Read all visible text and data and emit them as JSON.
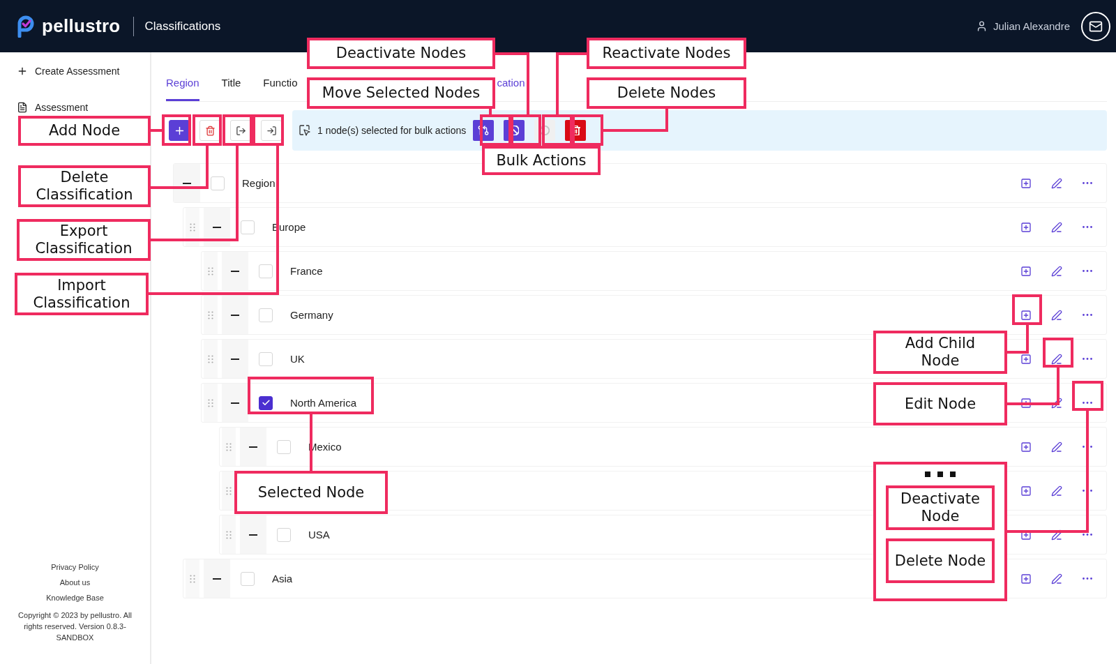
{
  "header": {
    "brand": "pellustro",
    "page_title": "Classifications",
    "user_name": "Julian Alexandre"
  },
  "sidebar": {
    "items": [
      {
        "label": "Create Assessment",
        "kind": "create"
      },
      {
        "label": "Assessment",
        "kind": "assessment"
      }
    ],
    "footer_links": [
      "Privacy Policy",
      "About us",
      "Knowledge Base"
    ],
    "copyright": "Copyright © 2023 by pellustro. All rights reserved. Version 0.8.3-SANDBOX"
  },
  "tabs": [
    {
      "label": "Region",
      "selected": true,
      "kind": "tab"
    },
    {
      "label": "Title",
      "selected": false,
      "kind": "tab"
    },
    {
      "label": "Functio",
      "selected": false,
      "kind": "tab"
    },
    {
      "label": "cation",
      "selected": false,
      "kind": "link"
    }
  ],
  "toolbar": [
    {
      "kind": "add"
    },
    {
      "kind": "delete"
    },
    {
      "kind": "export"
    },
    {
      "kind": "import"
    }
  ],
  "selection_bar": {
    "message": "1 node(s) selected for bulk actions",
    "actions": [
      {
        "kind": "move",
        "disabled": false
      },
      {
        "kind": "deactivate",
        "disabled": false
      },
      {
        "kind": "reactivate",
        "disabled": true
      },
      {
        "kind": "delete",
        "disabled": false
      }
    ]
  },
  "tree": [
    {
      "kind": "node",
      "label": "Region",
      "checked": false,
      "expanded": true,
      "children": [
        {
          "kind": "node",
          "label": "Europe",
          "checked": false,
          "expanded": true,
          "children": [
            {
              "kind": "node",
              "label": "France",
              "checked": false,
              "expanded": true
            },
            {
              "kind": "node",
              "label": "Germany",
              "checked": false,
              "expanded": true
            },
            {
              "kind": "node",
              "label": "UK",
              "checked": false,
              "expanded": true
            },
            {
              "kind": "node",
              "label": "North America",
              "checked": true,
              "expanded": true,
              "children": [
                {
                  "kind": "node",
                  "label": "Mexico",
                  "checked": false,
                  "expanded": true
                },
                {
                  "kind": "covered"
                },
                {
                  "kind": "node",
                  "label": "USA",
                  "checked": false,
                  "expanded": true
                }
              ]
            }
          ]
        },
        {
          "kind": "node",
          "label": "Asia",
          "checked": false,
          "expanded": true
        }
      ]
    }
  ],
  "annotations": [
    {
      "kind": "callout",
      "label": "Add Node"
    },
    {
      "kind": "callout",
      "label": "Delete Classification"
    },
    {
      "kind": "callout",
      "label": "Export Classification"
    },
    {
      "kind": "callout",
      "label": "Import Classification"
    },
    {
      "kind": "callout",
      "label": "Deactivate Nodes"
    },
    {
      "kind": "callout",
      "label": "Move Selected Nodes"
    },
    {
      "kind": "callout",
      "label": "Reactivate Nodes"
    },
    {
      "kind": "callout",
      "label": "Delete Nodes"
    },
    {
      "kind": "callout",
      "label": "Bulk Actions"
    },
    {
      "kind": "callout",
      "label": "Selected Node"
    },
    {
      "kind": "callout",
      "label": "Add Child Node"
    },
    {
      "kind": "callout",
      "label": "Edit Node"
    },
    {
      "kind": "menu",
      "items": [
        "Deactivate Node",
        "Delete Node"
      ]
    }
  ]
}
